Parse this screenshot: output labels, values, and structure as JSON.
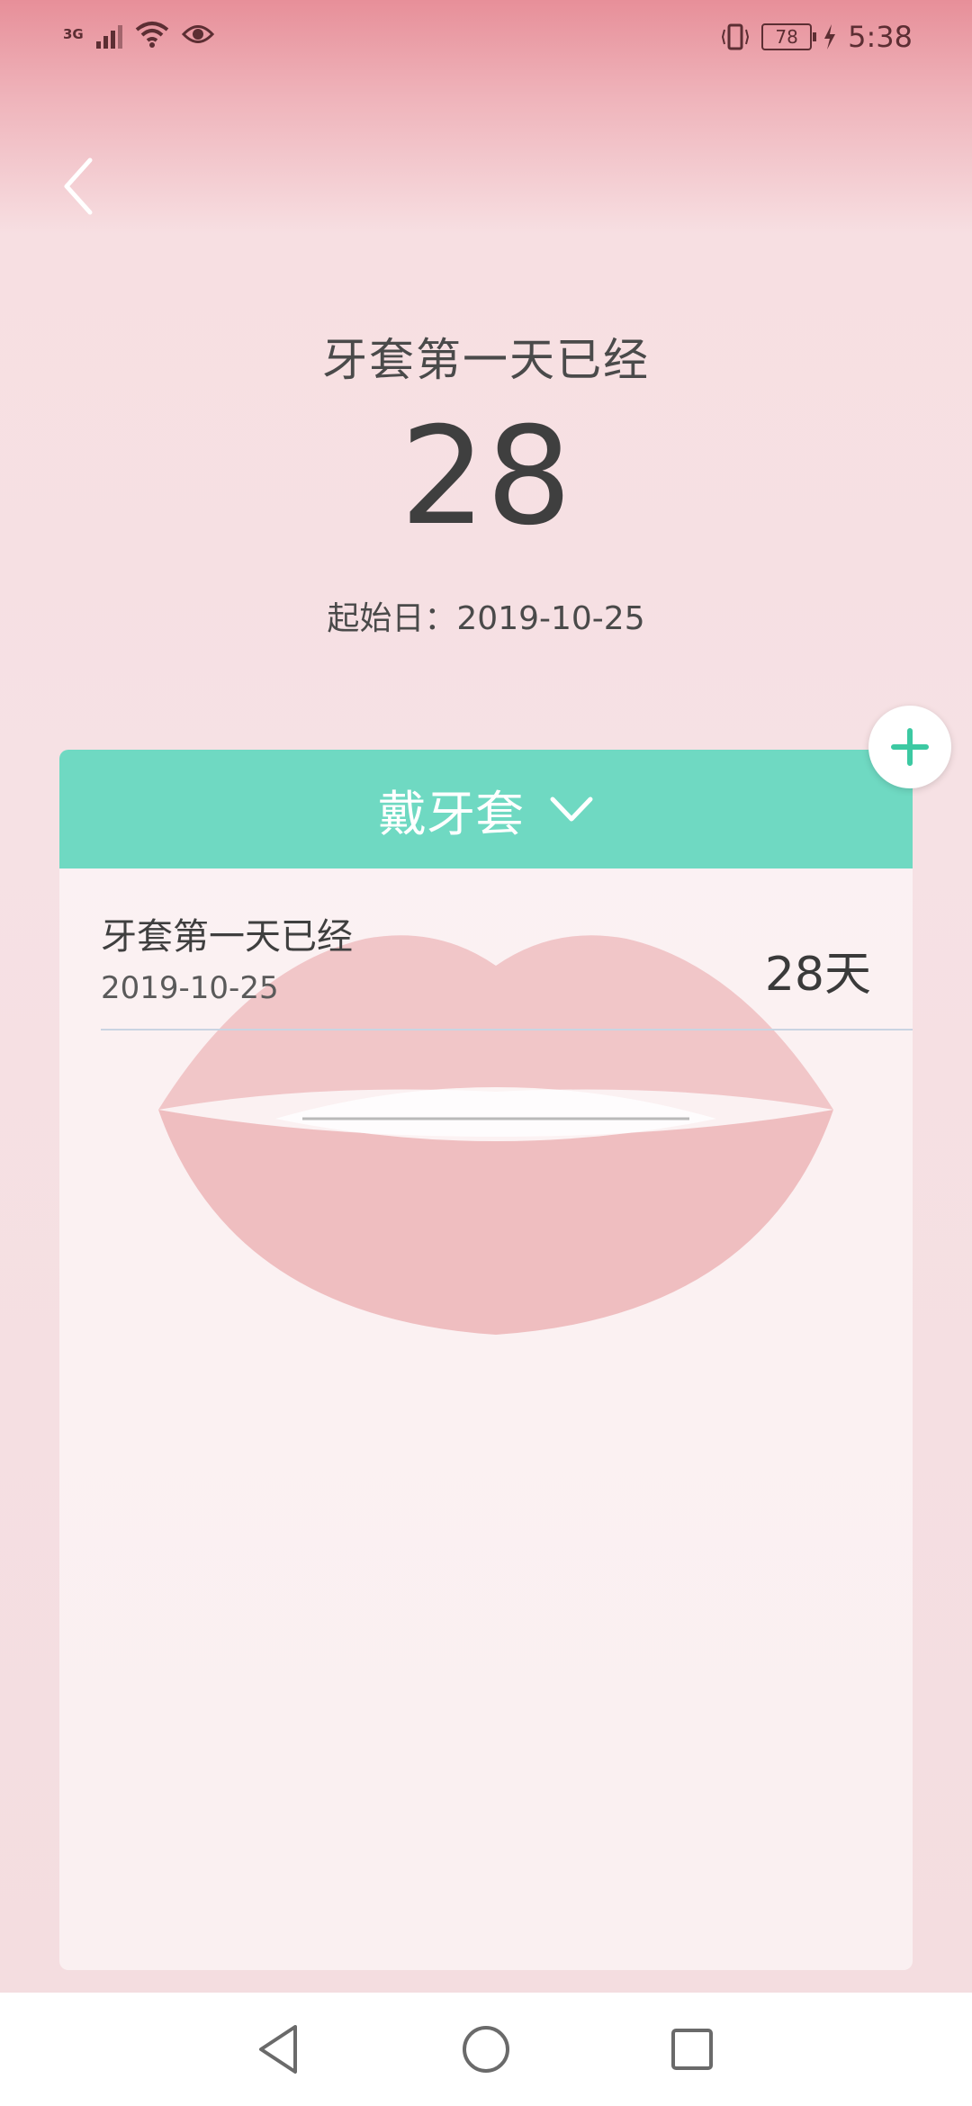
{
  "status": {
    "network": "3G",
    "battery": "78",
    "time": "5:38"
  },
  "header": {
    "title": "牙套第一天已经",
    "days": "28",
    "start_label": "起始日：",
    "start_date": "2019-10-25"
  },
  "card": {
    "dropdown_label": "戴牙套",
    "rows": [
      {
        "name": "牙套第一天已经",
        "date": "2019-10-25",
        "days": "28天"
      }
    ]
  },
  "colors": {
    "accent": "#6fd9c2",
    "background": "#f6e1e4"
  },
  "icons": {
    "back": "chevron-left-icon",
    "add": "plus-icon",
    "dropdown": "chevron-down-icon",
    "nav_back": "triangle-back-icon",
    "nav_home": "circle-home-icon",
    "nav_recent": "square-recent-icon"
  }
}
